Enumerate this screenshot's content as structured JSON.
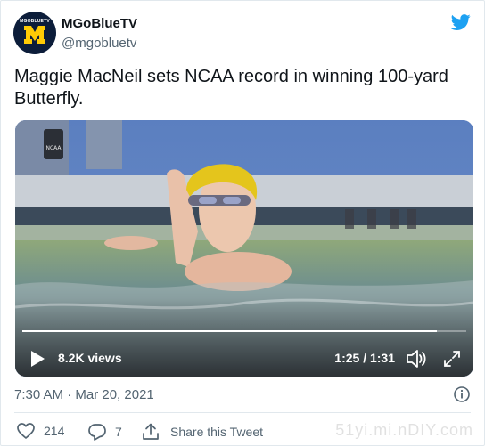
{
  "author": {
    "avatar_text": "MGOBLUETV",
    "name": "MGoBlueTV",
    "handle": "@mgobluetv"
  },
  "tweet": {
    "text": "Maggie MacNeil sets NCAA record in winning 100-yard Butterfly.",
    "timestamp": "7:30 AM · Mar 20, 2021"
  },
  "video": {
    "views": "8.2K views",
    "time": "1:25 / 1:31",
    "progress_fraction": 0.934,
    "overlay_badge": "NCAA"
  },
  "actions": {
    "likes": "214",
    "replies": "7",
    "share_label": "Share this Tweet"
  },
  "watermark": "51yi.mi.nDIY.com",
  "icons": [
    "twitter-bird-icon",
    "play-icon",
    "volume-icon",
    "fullscreen-icon",
    "info-icon",
    "heart-icon",
    "reply-icon",
    "share-icon"
  ],
  "colors": {
    "twitter_blue": "#1da1f2",
    "text_primary": "#0f1419",
    "text_secondary": "#536471",
    "michigan_maize": "#ffcb05",
    "michigan_blue": "#0c1d3a"
  }
}
